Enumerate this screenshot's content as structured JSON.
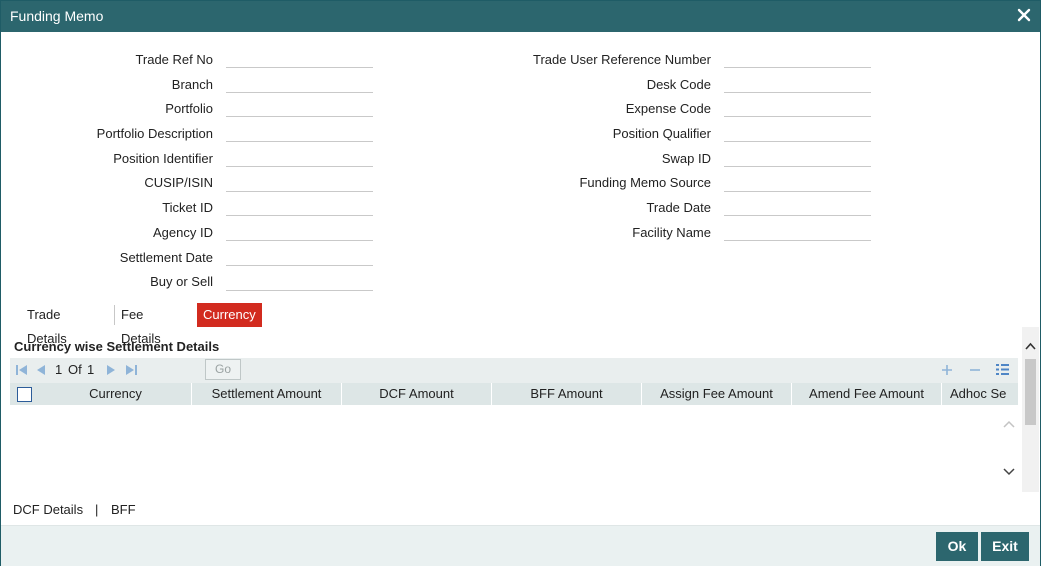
{
  "window": {
    "title": "Funding Memo"
  },
  "left_fields": [
    {
      "label": "Trade Ref No",
      "value": ""
    },
    {
      "label": "Branch",
      "value": ""
    },
    {
      "label": "Portfolio",
      "value": ""
    },
    {
      "label": "Portfolio Description",
      "value": ""
    },
    {
      "label": "Position Identifier",
      "value": ""
    },
    {
      "label": "CUSIP/ISIN",
      "value": ""
    },
    {
      "label": "Ticket ID",
      "value": ""
    },
    {
      "label": "Agency ID",
      "value": ""
    },
    {
      "label": "Settlement Date",
      "value": ""
    },
    {
      "label": "Buy or Sell",
      "value": ""
    }
  ],
  "right_fields": [
    {
      "label": "Trade User Reference Number",
      "value": ""
    },
    {
      "label": "Desk Code",
      "value": ""
    },
    {
      "label": "Expense Code",
      "value": ""
    },
    {
      "label": "Position Qualifier",
      "value": ""
    },
    {
      "label": "Swap ID",
      "value": ""
    },
    {
      "label": "Funding Memo Source",
      "value": ""
    },
    {
      "label": "Trade Date",
      "value": ""
    },
    {
      "label": "Facility Name",
      "value": ""
    }
  ],
  "tabs": [
    {
      "label": "Trade Details",
      "active": false
    },
    {
      "label": "Fee Details",
      "active": false
    },
    {
      "label": "Currency Details",
      "active": true
    }
  ],
  "grid": {
    "title": "Currency wise Settlement Details",
    "pager": {
      "page": "1",
      "of_label": "Of",
      "total": "1",
      "go_label": "Go"
    },
    "columns": [
      "Currency",
      "Settlement Amount",
      "DCF Amount",
      "BFF Amount",
      "Assign Fee Amount",
      "Amend Fee Amount",
      "Adhoc Se"
    ],
    "rows": []
  },
  "bottom_links": {
    "dcf_details": "DCF Details",
    "separator": "|",
    "bff": "BFF"
  },
  "footer": {
    "ok_label": "Ok",
    "exit_label": "Exit"
  },
  "colors": {
    "title_bar": "#2c666e",
    "active_tab": "#d22b1f",
    "button": "#2c666e",
    "toolbar_icon": "#4f86c6"
  },
  "icons": [
    "close-icon",
    "first-page-icon",
    "prev-page-icon",
    "next-page-icon",
    "last-page-icon",
    "add-row-icon",
    "delete-row-icon",
    "list-view-icon",
    "scroll-up-icon",
    "scroll-down-icon"
  ]
}
